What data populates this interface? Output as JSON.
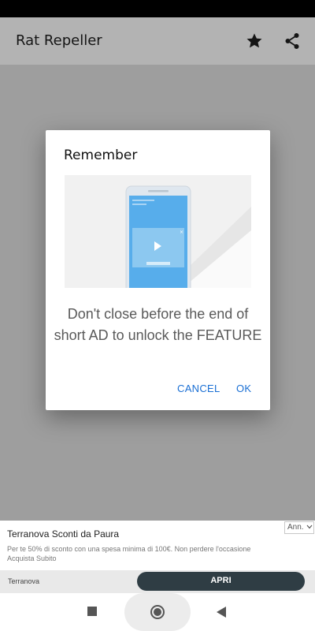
{
  "app_bar": {
    "title": "Rat Repeller",
    "star_icon": "star-icon",
    "share_icon": "share-icon"
  },
  "dialog": {
    "title": "Remember",
    "message": "Don't close before the end of short AD to unlock the FEATURE",
    "cancel_label": "CANCEL",
    "ok_label": "OK",
    "illustration_icon": "phone-video-ad-illustration"
  },
  "ad": {
    "title": "Terranova Sconti da Paura",
    "choices_label": "Ann.",
    "body_line1": "Per te 50% di sconto con una spesa minima di 100€. Non perdere l'occasione",
    "body_line2": "Acquista Subito",
    "advertiser": "Terranova",
    "cta_label": "APRI"
  },
  "nav_bar": {
    "recents_icon": "square-icon",
    "home_icon": "circle-icon",
    "back_icon": "triangle-back-icon"
  },
  "colors": {
    "accent": "#1a6fd4",
    "scrim": "#9e9e9e",
    "cta_background": "#2f3d44"
  }
}
